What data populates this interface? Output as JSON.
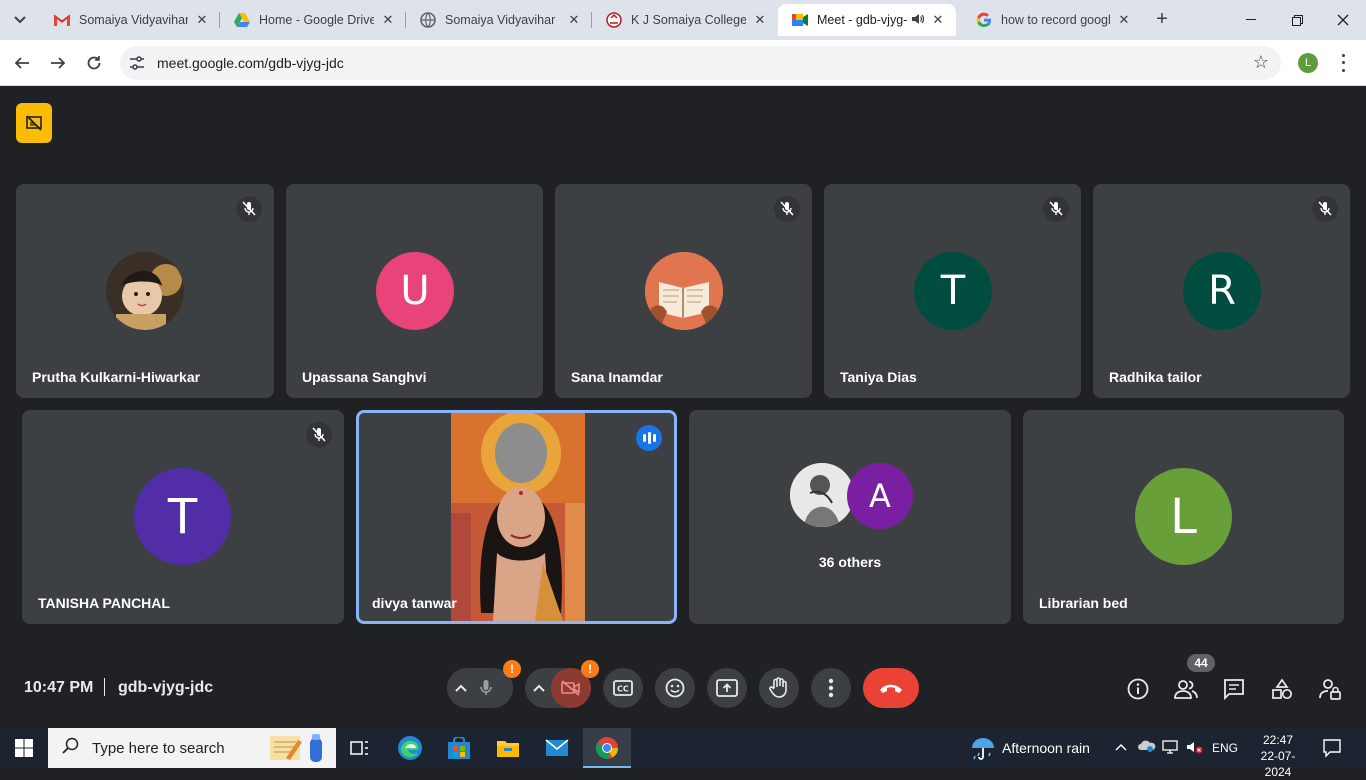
{
  "browser": {
    "tabs": [
      {
        "title": "Somaiya Vidyavihar M",
        "favicon": "gmail-icon",
        "color": "#ea4335",
        "active": false
      },
      {
        "title": "Home - Google Drive",
        "favicon": "drive-icon",
        "color": "#34a853",
        "active": false
      },
      {
        "title": "Somaiya Vidyavihar",
        "favicon": "globe-icon",
        "color": "#5f6368",
        "active": false
      },
      {
        "title": "K J Somaiya College o",
        "favicon": "college-icon",
        "color": "#b71c1c",
        "active": false
      },
      {
        "title": "Meet - gdb-vjyg-j",
        "favicon": "meet-icon",
        "color": "#00897b",
        "active": true,
        "audio": true
      },
      {
        "title": "how to record googl",
        "favicon": "google-icon",
        "color": "#4285f4",
        "active": false
      }
    ],
    "url": "meet.google.com/gdb-vjyg-jdc",
    "profile_initial": "L"
  },
  "meet": {
    "participants_row1": [
      {
        "name": "Prutha Kulkarni-Hiwarkar",
        "avatar": "photo",
        "muted": true
      },
      {
        "name": "Upassana Sanghvi",
        "avatar_letter": "U",
        "color": "#e8447a",
        "muted": false
      },
      {
        "name": "Sana Inamdar",
        "avatar": "photo",
        "muted": true
      },
      {
        "name": "Taniya Dias",
        "avatar_letter": "T",
        "color": "#004d40",
        "muted": true
      },
      {
        "name": "Radhika tailor",
        "avatar_letter": "R",
        "color": "#004d40",
        "muted": true
      }
    ],
    "participants_row2": [
      {
        "name": "TANISHA PANCHAL",
        "avatar_letter": "T",
        "color": "#512da8",
        "muted": true
      },
      {
        "name": "divya tanwar",
        "video": true,
        "speaking": true
      },
      {
        "name": "36 others",
        "avatar_letter": "A",
        "color": "#7b1fa2"
      },
      {
        "name": "Librarian bed",
        "avatar_letter": "L",
        "color": "#689f38"
      }
    ],
    "clock": "10:47 PM",
    "meeting_code": "gdb-vjyg-jdc",
    "participant_count": "44",
    "accent": "#8ab4f8",
    "end_call_color": "#ea4335"
  },
  "taskbar": {
    "search_placeholder": "Type here to search",
    "weather": "Afternoon rain",
    "language": "ENG",
    "time": "22:47",
    "date": "22-07-2024"
  }
}
